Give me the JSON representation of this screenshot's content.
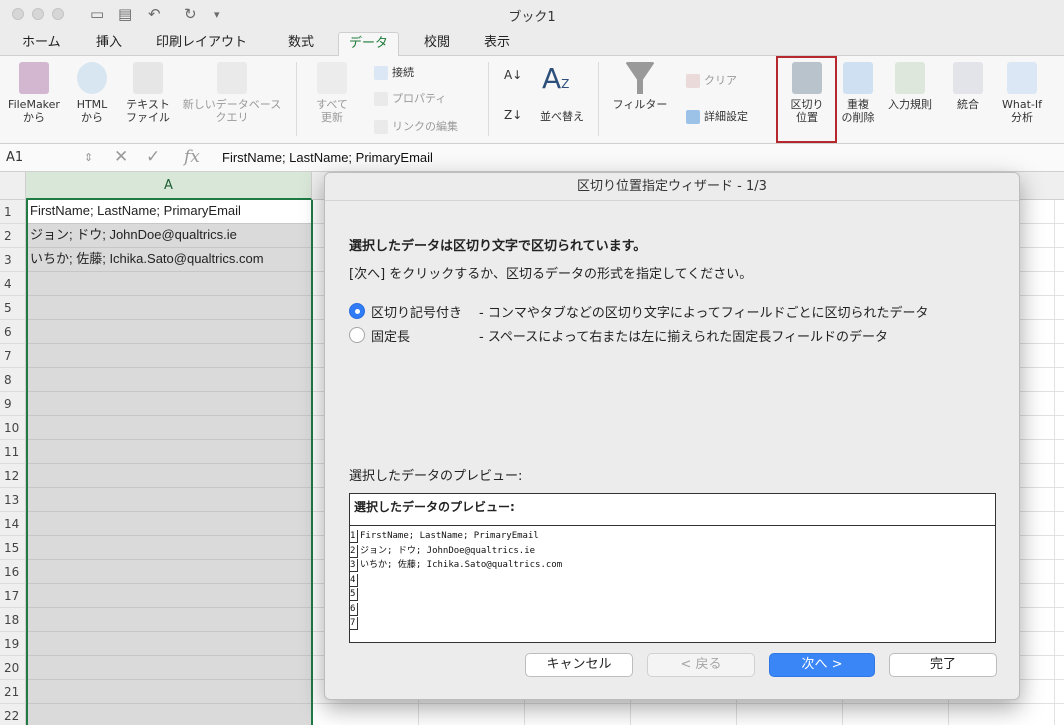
{
  "window": {
    "title": "ブック1"
  },
  "tabs": [
    "ホーム",
    "挿入",
    "印刷レイアウト",
    "数式",
    "データ",
    "校閲",
    "表示"
  ],
  "active_tab": "データ",
  "ribbon": {
    "filemaker": "FileMaker\nから",
    "html": "HTML\nから",
    "text_file": "テキスト\nファイル",
    "new_query": "新しいデータベース\nクエリ",
    "refresh_all": "すべて\n更新",
    "connections": "接続",
    "properties": "プロパティ",
    "edit_links": "リンクの編集",
    "sort": "並べ替え",
    "filter": "フィルター",
    "clear": "クリア",
    "advanced": "詳細設定",
    "text_to_columns": "区切り\n位置",
    "remove_dupes": "重複\nの削除",
    "validation": "入力規則",
    "consolidate": "統合",
    "whatif": "What-If\n分析"
  },
  "formula_bar": {
    "name_box": "A1",
    "fx": "fx",
    "formula": "FirstName; LastName; PrimaryEmail"
  },
  "sheet": {
    "column_header": "A",
    "rows": [
      "1",
      "2",
      "3",
      "4",
      "5",
      "6",
      "7",
      "8",
      "9",
      "10",
      "11",
      "12",
      "13",
      "14",
      "15",
      "16",
      "17",
      "18",
      "19",
      "20",
      "21",
      "22"
    ],
    "cells": [
      "FirstName; LastName; PrimaryEmail",
      "ジョン; ドウ; JohnDoe@qualtrics.ie",
      "いちか; 佐藤; Ichika.Sato@qualtrics.com"
    ]
  },
  "dialog": {
    "title": "区切り位置指定ウィザード - 1/3",
    "heading": "選択したデータは区切り文字で区切られています。",
    "instruction": "[次へ] をクリックするか、区切るデータの形式を指定してください。",
    "option1_label": "区切り記号付き",
    "option1_desc": "- コンマやタブなどの区切り文字によってフィールドごとに区切られたデータ",
    "option2_label": "固定長",
    "option2_desc": "- スペースによって右または左に揃えられた固定長フィールドのデータ",
    "preview_label": "選択したデータのプレビュー:",
    "preview_header": "選択したデータのプレビュー:",
    "preview_lines": [
      {
        "num": "1",
        "text": "FirstName; LastName; PrimaryEmail"
      },
      {
        "num": "2",
        "text": "ジョン; ドウ; JohnDoe@qualtrics.ie"
      },
      {
        "num": "3",
        "text": "いちか; 佐藤; Ichika.Sato@qualtrics.com"
      },
      {
        "num": "4",
        "text": ""
      },
      {
        "num": "5",
        "text": ""
      },
      {
        "num": "6",
        "text": ""
      },
      {
        "num": "7",
        "text": ""
      }
    ],
    "cancel": "キャンセル",
    "back": "< 戻る",
    "next": "次へ >",
    "finish": "完了"
  }
}
